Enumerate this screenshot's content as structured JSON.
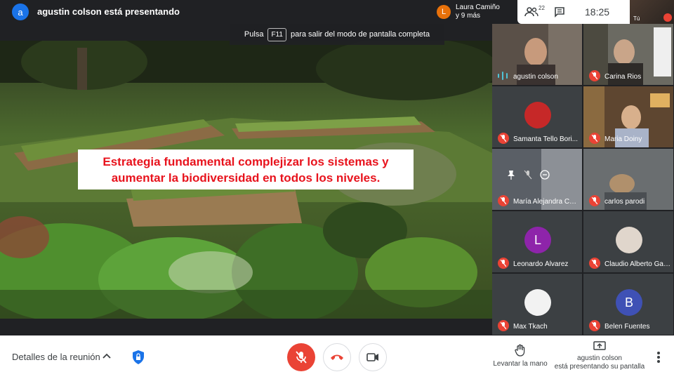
{
  "header": {
    "presenter_initial": "a",
    "presenting_text": "agustin colson está presentando",
    "attendee_initial": "L",
    "attendee_name": "Laura Camiño",
    "attendee_more": "y 9 más",
    "people_count": "22",
    "time": "18:25",
    "self_label": "Tú"
  },
  "fullscreen_hint": {
    "prefix": "Pulsa",
    "key": "F11",
    "suffix": "para salir del modo de pantalla completa"
  },
  "slide": {
    "caption_line1": "Estrategia fundamental complejizar los sistemas y",
    "caption_line2": "aumentar la biodiversidad en todos los niveles."
  },
  "participants": [
    {
      "name": "agustin colson",
      "status": "speaking",
      "type": "video"
    },
    {
      "name": "Carina Rios",
      "status": "muted",
      "type": "video"
    },
    {
      "name": "Samanta Tello Bori...",
      "status": "muted",
      "type": "photo"
    },
    {
      "name": "Maria Doiny",
      "status": "muted",
      "type": "video"
    },
    {
      "name": "María Alejandra Car...",
      "status": "muted",
      "type": "video"
    },
    {
      "name": "carlos parodi",
      "status": "muted",
      "type": "video"
    },
    {
      "name": "Leonardo Álvarez",
      "status": "muted",
      "type": "initial",
      "initial": "L",
      "color": "#8e24aa"
    },
    {
      "name": "Claudio Alberto Gar...",
      "status": "muted",
      "type": "photo"
    },
    {
      "name": "Max Tkach",
      "status": "muted",
      "type": "photo"
    },
    {
      "name": "Belen Fuentes",
      "status": "muted",
      "type": "initial",
      "initial": "B",
      "color": "#3f51b5"
    }
  ],
  "bottom": {
    "meeting_details": "Detalles de la reunión",
    "raise_hand": "Levantar la mano",
    "presenting_line1": "agustin colson",
    "presenting_line2": "está presentando su pantalla"
  },
  "colors": {
    "accent_red": "#ea4335",
    "blue": "#1a73e8",
    "speaking_cyan": "#46d4d4"
  }
}
